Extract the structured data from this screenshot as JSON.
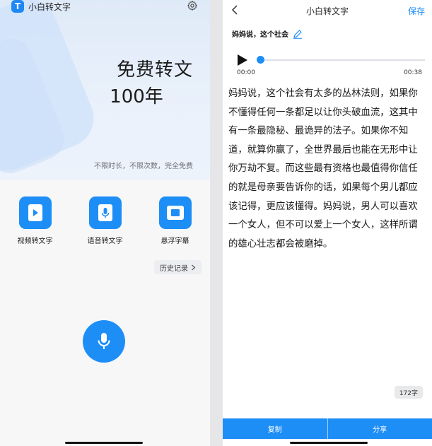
{
  "left": {
    "app_title": "小白转文字",
    "promo_title": "免费转文",
    "promo_years": "100年",
    "promo_tagline": "不限时长，不限次数，完全免费",
    "features": [
      {
        "label": "视频转文字",
        "icon": "video-play-icon"
      },
      {
        "label": "语音转文字",
        "icon": "microphone-file-icon"
      },
      {
        "label": "悬浮字幕",
        "icon": "floating-window-icon"
      }
    ],
    "history_label": "历史记录",
    "colors": {
      "accent": "#1e8ef7",
      "hero_bg": "#e6eefa"
    }
  },
  "right": {
    "nav_title": "小白转文字",
    "save_label": "保存",
    "doc_title": "妈妈说，这个社会",
    "player": {
      "current_time": "00:00",
      "total_time": "00:38",
      "progress": 0.0
    },
    "transcript": "妈妈说，这个社会有太多的丛林法则，如果你不懂得任何一条都足以让你头破血流，这其中有一条最隐秘、最诡异的法子。如果你不知道，就算你赢了，全世界最后也能在无形中让你万劫不复。而这些最有资格也最值得你信任的就是母亲要告诉你的话，如果每个男儿都应该记得，更应该懂得。妈妈说，男人可以喜欢一个女人，但不可以爱上一个女人，这样所谓的雄心壮志都会被磨掉。",
    "word_count": "172字",
    "copy_label": "复制",
    "share_label": "分享"
  }
}
